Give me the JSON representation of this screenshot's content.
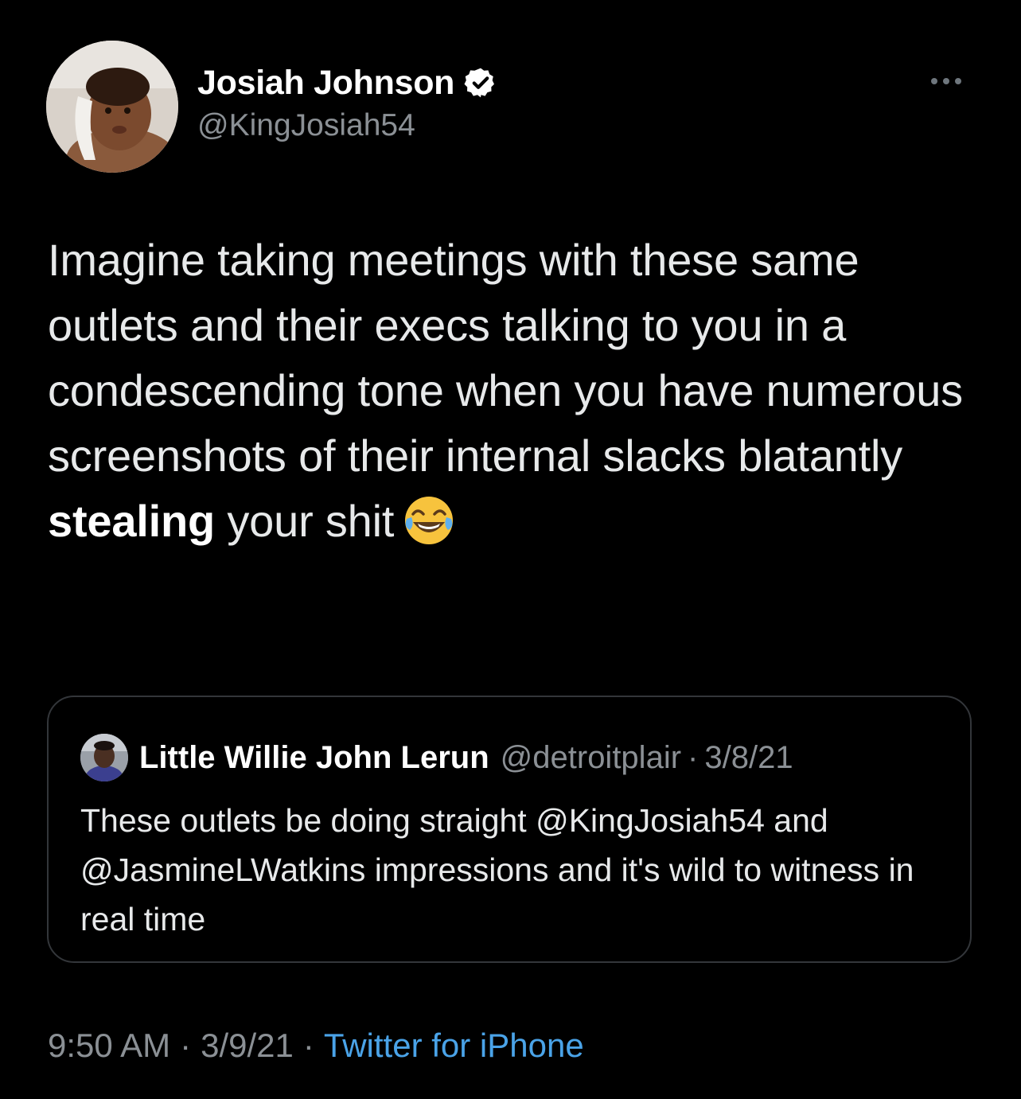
{
  "tweet": {
    "display_name": "Josiah Johnson",
    "handle": "@KingJosiah54",
    "text_before_bold": "Imagine taking meetings with these same outlets and their execs talking to you in a condescending tone when you have numerous screenshots of their internal slacks blatantly ",
    "text_bold": "stealing",
    "text_after_bold": " your shit",
    "emoji_name": "face-with-tears-of-joy",
    "time": "9:50 AM",
    "date": "3/9/21",
    "source": "Twitter for iPhone",
    "separator": "·"
  },
  "quoted_tweet": {
    "display_name": "Little Willie John Lerun",
    "handle": "@detroitplair",
    "separator": "·",
    "date": "3/8/21",
    "text": "These outlets be doing straight @KingJosiah54 and @JasmineLWatkins impressions and it's wild to witness in real time"
  },
  "icons": {
    "verified": "verified-badge-icon",
    "more": "more-options-icon"
  },
  "colors": {
    "background": "#000000",
    "text": "#e7e9ea",
    "secondary": "#8b9095",
    "link": "#4aa3e8",
    "border": "#33363a"
  }
}
